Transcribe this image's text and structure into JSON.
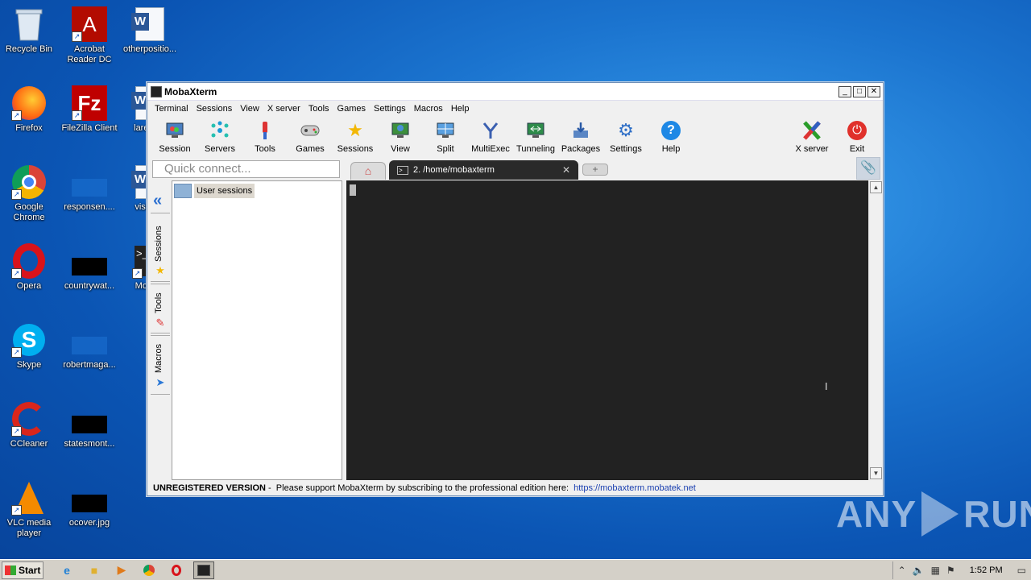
{
  "desktop": {
    "icons": [
      {
        "label": "Recycle Bin"
      },
      {
        "label": "Acrobat Reader DC"
      },
      {
        "label": "otherpositio..."
      },
      {
        "label": "Firefox"
      },
      {
        "label": "FileZilla Client"
      },
      {
        "label": "larega..."
      },
      {
        "label": "Google Chrome"
      },
      {
        "label": "responsen...."
      },
      {
        "label": "visitef..."
      },
      {
        "label": "Opera"
      },
      {
        "label": "countrywat..."
      },
      {
        "label": "Moba..."
      },
      {
        "label": "Skype"
      },
      {
        "label": "robertmaga..."
      },
      {
        "label": "CCleaner"
      },
      {
        "label": "statesmont..."
      },
      {
        "label": "VLC media player"
      },
      {
        "label": "ocover.jpg"
      }
    ]
  },
  "window": {
    "title": "MobaXterm",
    "controls": {
      "minimize": "_",
      "maximize": "□",
      "close": "✕"
    }
  },
  "menu": [
    "Terminal",
    "Sessions",
    "View",
    "X server",
    "Tools",
    "Games",
    "Settings",
    "Macros",
    "Help"
  ],
  "toolbar": {
    "left": [
      {
        "label": "Session",
        "icon": "session-icon"
      },
      {
        "label": "Servers",
        "icon": "servers-icon"
      },
      {
        "label": "Tools",
        "icon": "tools-icon"
      },
      {
        "label": "Games",
        "icon": "games-icon"
      },
      {
        "label": "Sessions",
        "icon": "star-icon"
      },
      {
        "label": "View",
        "icon": "view-icon"
      },
      {
        "label": "Split",
        "icon": "split-icon"
      },
      {
        "label": "MultiExec",
        "icon": "multiexec-icon"
      },
      {
        "label": "Tunneling",
        "icon": "tunneling-icon"
      },
      {
        "label": "Packages",
        "icon": "packages-icon"
      },
      {
        "label": "Settings",
        "icon": "gear-icon"
      },
      {
        "label": "Help",
        "icon": "help-icon"
      }
    ],
    "right": [
      {
        "label": "X server",
        "icon": "xserver-icon"
      },
      {
        "label": "Exit",
        "icon": "power-icon"
      }
    ]
  },
  "quick_connect": {
    "placeholder": "Quick connect..."
  },
  "tabs": {
    "active_label": "2. /home/mobaxterm",
    "close": "✕"
  },
  "sidebar": {
    "tabs": [
      "Sessions",
      "Tools",
      "Macros"
    ],
    "user_sessions_label": "User sessions"
  },
  "status": {
    "prefix": "UNREGISTERED VERSION",
    "message": " -  Please support MobaXterm by subscribing to the professional edition here:  ",
    "link": "https://mobaxterm.mobatek.net"
  },
  "watermark": {
    "left": "ANY",
    "right": "RUN"
  },
  "taskbar": {
    "start_label": "Start",
    "clock": "1:52 PM"
  }
}
